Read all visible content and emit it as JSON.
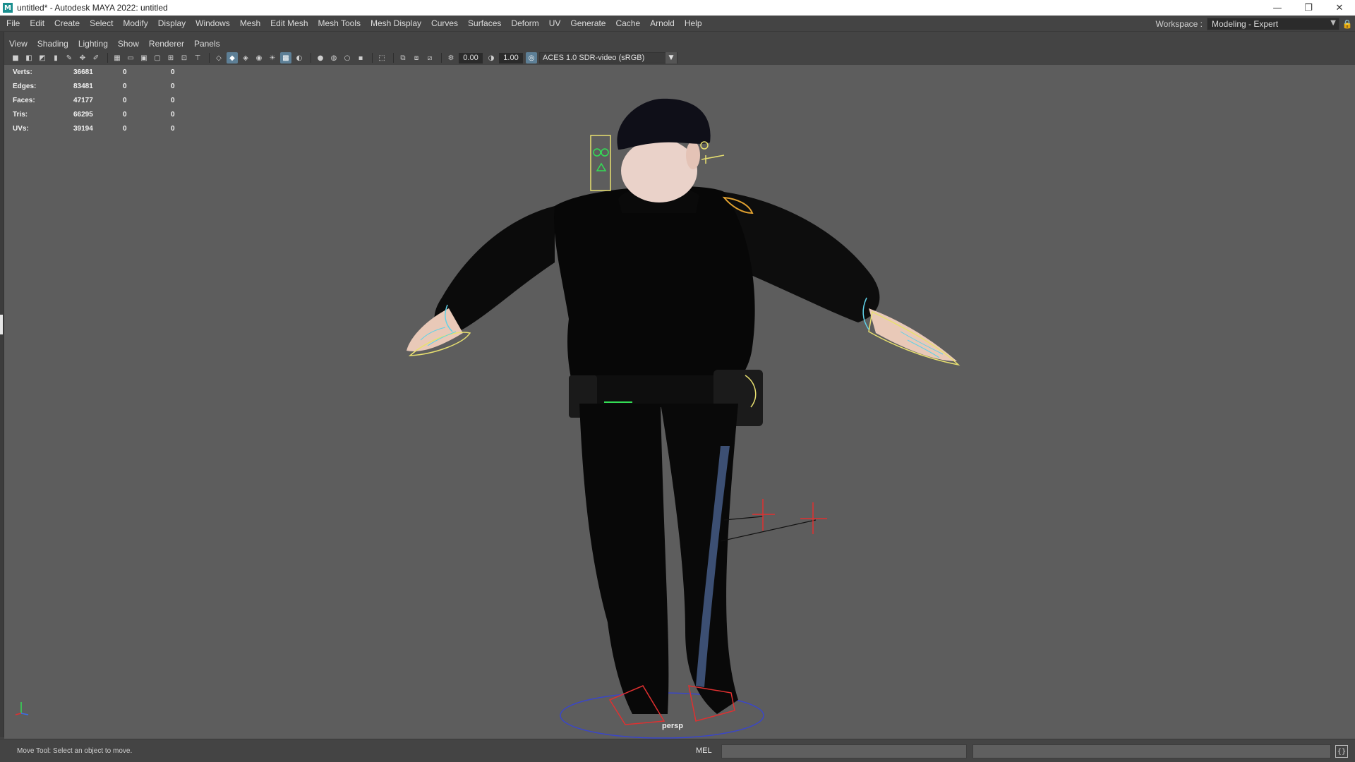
{
  "window": {
    "title": "untitled* - Autodesk MAYA 2022: untitled",
    "app_icon": "M",
    "minimize_glyph": "—",
    "maximize_glyph": "❐",
    "close_glyph": "✕"
  },
  "menu": [
    "File",
    "Edit",
    "Create",
    "Select",
    "Modify",
    "Display",
    "Windows",
    "Mesh",
    "Edit Mesh",
    "Mesh Tools",
    "Mesh Display",
    "Curves",
    "Surfaces",
    "Deform",
    "UV",
    "Generate",
    "Cache",
    "Arnold",
    "Help"
  ],
  "workspace": {
    "label": "Workspace :",
    "value": "Modeling - Expert",
    "arrow": "▼",
    "lock_glyph": "🔒"
  },
  "panel_menu": [
    "View",
    "Shading",
    "Lighting",
    "Show",
    "Renderer",
    "Panels"
  ],
  "panel_toolbar": {
    "exposure": "0.00",
    "gamma": "1.00",
    "color_space": "ACES 1.0 SDR-video (sRGB)",
    "color_space_arrow": "▼"
  },
  "hud": [
    {
      "label": "Verts:",
      "v1": "36681",
      "v2": "0",
      "v3": "0"
    },
    {
      "label": "Edges:",
      "v1": "83481",
      "v2": "0",
      "v3": "0"
    },
    {
      "label": "Faces:",
      "v1": "47177",
      "v2": "0",
      "v3": "0"
    },
    {
      "label": "Tris:",
      "v1": "66295",
      "v2": "0",
      "v3": "0"
    },
    {
      "label": "UVs:",
      "v1": "39194",
      "v2": "0",
      "v3": "0"
    }
  ],
  "viewport": {
    "camera": "persp",
    "background": "#5d5d5d"
  },
  "status": {
    "help_line": "Move Tool: Select an object to move.",
    "command_language": "MEL",
    "script_editor_glyph": "{}"
  },
  "colors": {
    "accent_active": "#5d7f96",
    "control_yellow": "#e8e070",
    "control_cyan": "#5fd2e8",
    "control_red": "#e03030",
    "control_green": "#33dd55"
  }
}
